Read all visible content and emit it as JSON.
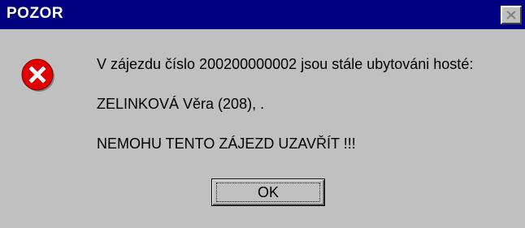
{
  "window": {
    "title": "POZOR"
  },
  "icon": {
    "type": "error-icon",
    "color": "#e00000"
  },
  "message": {
    "line1": "V zájezdu číslo 200200000002 jsou stále ubytováni hosté:",
    "line2": "ZELINKOVÁ Věra (208), .",
    "line3": "NEMOHU TENTO ZÁJEZD UZAVŘÍT !!!"
  },
  "buttons": {
    "ok_label": "OK"
  },
  "colors": {
    "titlebar": "#000080",
    "face": "#c0c0c0"
  }
}
